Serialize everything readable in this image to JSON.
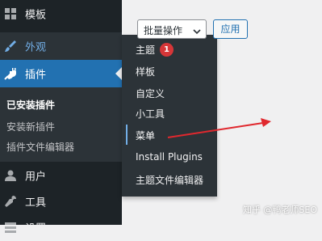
{
  "sidebar": {
    "templates": {
      "label": "模板",
      "icon": "templates-icon"
    },
    "appearance": {
      "label": "外观",
      "icon": "appearance-brush-icon"
    },
    "plugins": {
      "label": "插件",
      "icon": "plugins-icon"
    },
    "plugins_submenu": {
      "installed": "已安装插件",
      "add_new": "安装新插件",
      "file_editor": "插件文件编辑器"
    },
    "users": {
      "label": "用户",
      "icon": "users-icon"
    },
    "tools": {
      "label": "工具",
      "icon": "tools-icon"
    },
    "settings": {
      "label": "设置",
      "icon": "settings-icon"
    }
  },
  "appearance_flyout": {
    "items": [
      {
        "label": "主题"
      },
      {
        "label": "样板"
      },
      {
        "label": "自定义"
      },
      {
        "label": "小工具"
      },
      {
        "label": "菜单"
      },
      {
        "label": "Install Plugins"
      },
      {
        "label": "主题文件编辑器"
      }
    ],
    "themes_badge": "1",
    "active_item": "菜单"
  },
  "toolbar": {
    "bulk_actions": "批量操作",
    "apply_button": "应用"
  },
  "watermark": "知乎 @鸭老师SEO",
  "colors": {
    "sidebar_bg": "#1d2327",
    "submenu_bg": "#2c3338",
    "active_blue": "#2271b1",
    "highlight_blue": "#72aee6",
    "badge_red": "#d63638",
    "annotation_red": "#e0282e"
  }
}
